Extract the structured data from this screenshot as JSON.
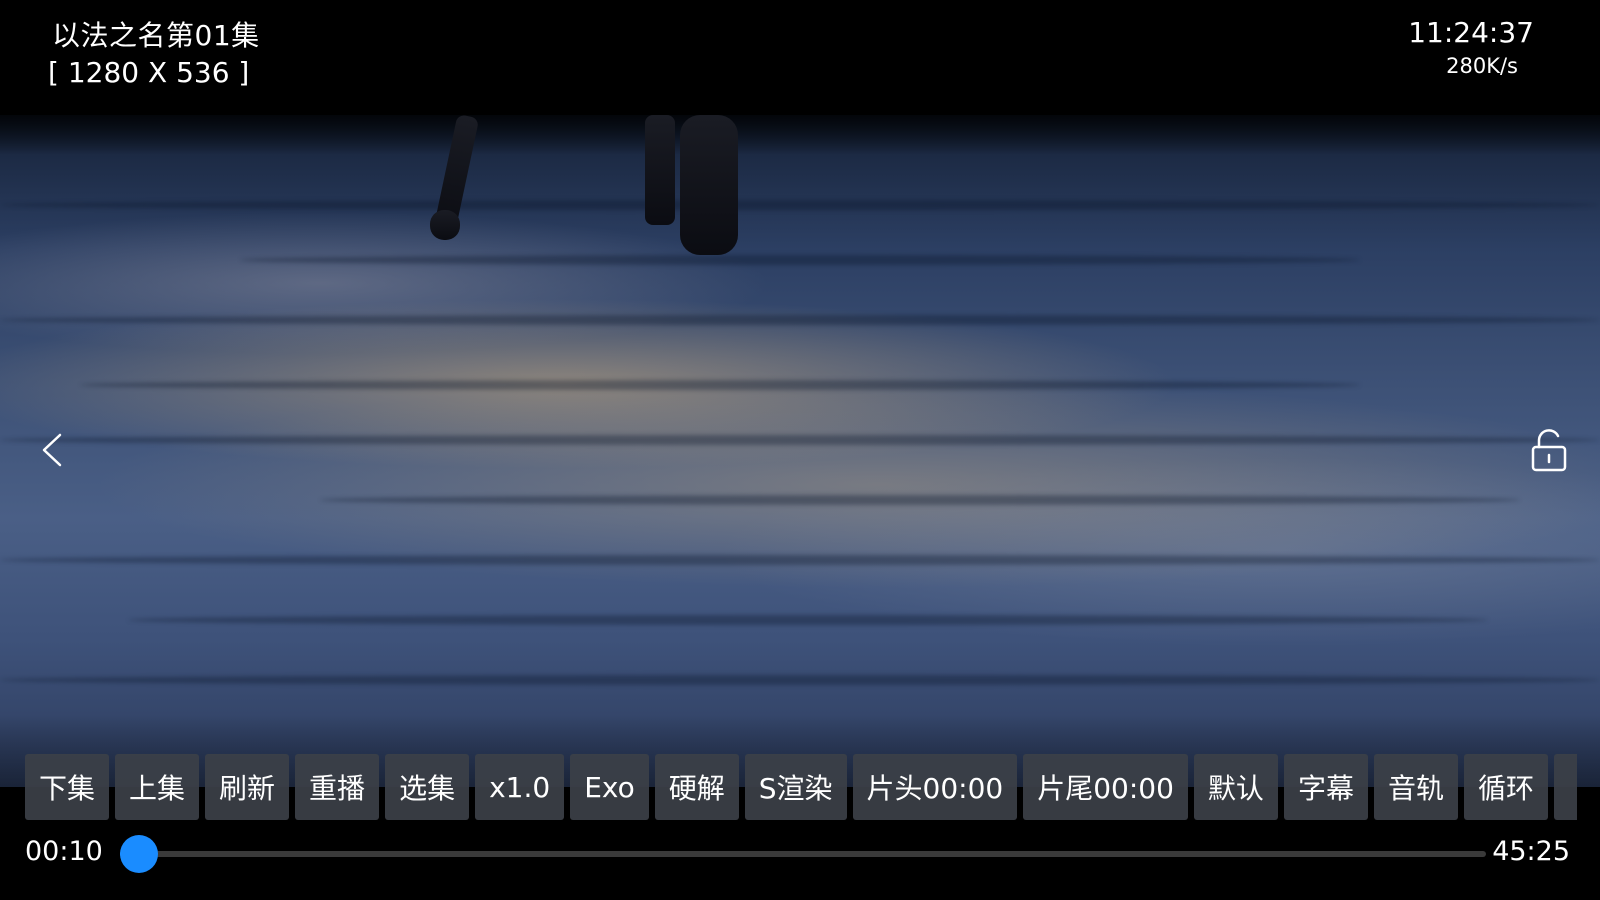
{
  "header": {
    "title": "以法之名第01集",
    "resolution": "[ 1280 X 536 ]",
    "clock": "11:24:37",
    "speed": "280K/s"
  },
  "icons": {
    "back": "chevron-left-icon",
    "lock": "unlock-icon"
  },
  "controls": [
    "下集",
    "上集",
    "刷新",
    "重播",
    "选集",
    "x1.0",
    "Exo",
    "硬解",
    "S渲染",
    "片头00:00",
    "片尾00:00",
    "默认",
    "字幕",
    "音轨",
    "循环"
  ],
  "progress": {
    "current": "00:10",
    "total": "45:25",
    "fraction": 0.0037
  },
  "colors": {
    "accent": "#1a8cff",
    "button_bg": "#3c4048"
  }
}
